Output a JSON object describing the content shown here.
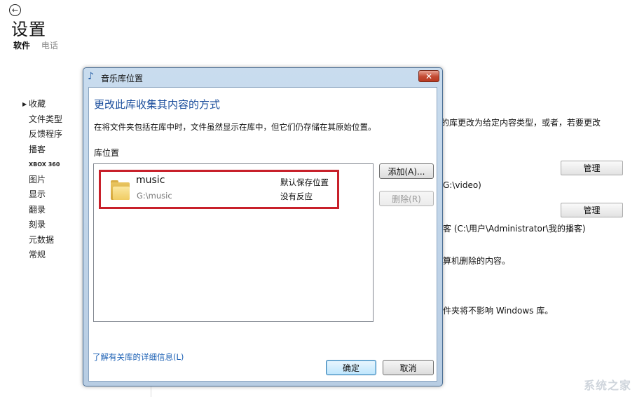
{
  "page": {
    "title": "设置",
    "tabs": [
      {
        "label": "软件",
        "active": true
      },
      {
        "label": "电话",
        "active": false
      }
    ],
    "nav": [
      "收藏",
      "文件类型",
      "反馈程序",
      "播客",
      "XBOX 360",
      "图片",
      "显示",
      "翻录",
      "刻录",
      "元数据",
      "常规"
    ],
    "right_texts": [
      "的库更改为给定内容类型，或者，若要更改",
      "G:\\video)",
      "客 (C:\\用户\\Administrator\\我的播客)",
      "算机删除的内容。",
      "件夹将不影响 Windows 库。"
    ],
    "manage_label": "管理",
    "watermark": "系统之家"
  },
  "dialog": {
    "title": "音乐库位置",
    "close_glyph": "✕",
    "heading": "更改此库收集其内容的方式",
    "description": "在将文件夹包括在库中时，文件虽然显示在库中，但它们仍存储在其原始位置。",
    "locations_label": "库位置",
    "item": {
      "name": "music",
      "path": "G:\\music",
      "status_default": "默认保存位置",
      "status_note": "没有反应"
    },
    "add_button": "添加(A)...",
    "remove_button": "删除(R)",
    "info_link": "了解有关库的详细信息(L)",
    "ok_button": "确定",
    "cancel_button": "取消",
    "highlight_color": "#c8202a"
  }
}
